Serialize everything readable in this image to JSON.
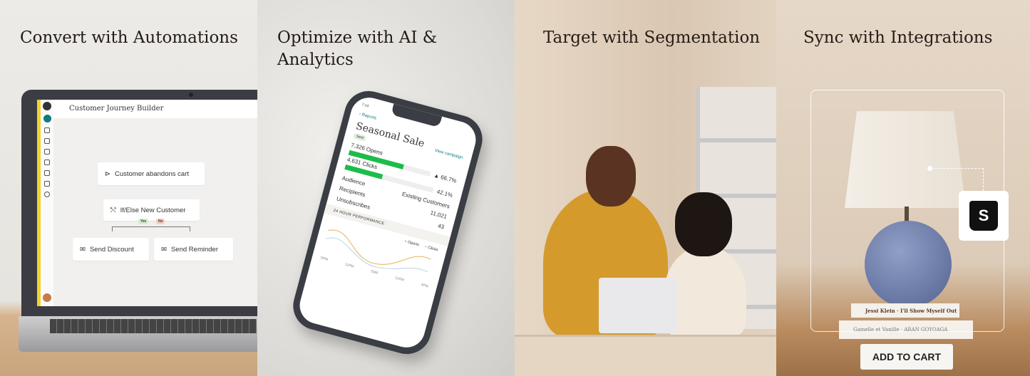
{
  "panels": [
    {
      "title": "Convert with Automations"
    },
    {
      "title": "Optimize with AI & Analytics"
    },
    {
      "title": "Target with Segmentation"
    },
    {
      "title": "Sync with Integrations"
    }
  ],
  "journey": {
    "header": "Customer Journey Builder",
    "trigger": "Customer abandons cart",
    "condition": "If/Else New Customer",
    "yes": "Yes",
    "no": "No",
    "action_left": "Send Discount",
    "action_right": "Send Reminder"
  },
  "report": {
    "time": "7:14",
    "back": "Reports",
    "title": "Seasonal Sale",
    "badge": "Sent",
    "view": "View campaign",
    "opens_label": "7,326 Opens",
    "opens_pct": "▲ 66.7%",
    "opens_fill": 66.7,
    "clicks_label": "4,631 Clicks",
    "clicks_pct": "42.1%",
    "clicks_fill": 42.1,
    "rows": [
      {
        "k": "Audience",
        "v": "Existing Customers"
      },
      {
        "k": "Recipients",
        "v": "11,021"
      },
      {
        "k": "Unsubscribes",
        "v": "43"
      }
    ],
    "perf": "24 HOUR PERFORMANCE",
    "legend": [
      "Opens",
      "Clicks"
    ],
    "ticks": [
      "5PM",
      "11PM",
      "5AM",
      "11AM",
      "4PM"
    ],
    "colors": {
      "opens": "#e3b45a",
      "clicks": "#b9d3e6",
      "bar": "#1bbd4a"
    }
  },
  "books": [
    "Jessi Klein · I'll Show Myself Out",
    "Gamelle et Vanille · ARAN GOYOAGA"
  ],
  "cart_button": "ADD TO CART"
}
